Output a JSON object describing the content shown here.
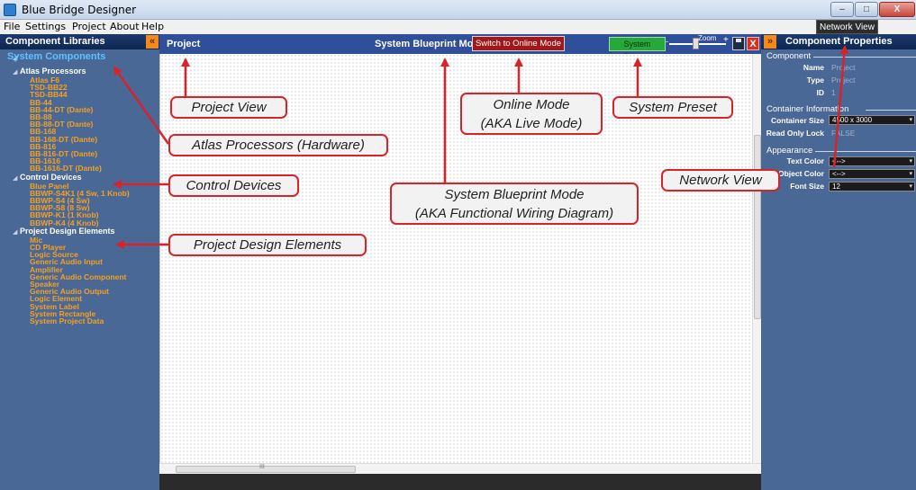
{
  "window": {
    "title": "Blue Bridge Designer",
    "controls": {
      "minimize": "–",
      "maximize": "□",
      "close": "X"
    }
  },
  "menu": {
    "file": "File",
    "settings": "Settings",
    "project": "Project",
    "about": "About",
    "help": "Help"
  },
  "tooltip": "Network View",
  "left_panel": {
    "title": "Component Libraries",
    "collapse_glyph": "«",
    "root": "System Components",
    "categories": [
      {
        "label": "Atlas Processors",
        "items": [
          "Atlas F6",
          "TSD-BB22",
          "TSD-BB44",
          "BB-44",
          "BB-44-DT (Dante)",
          "BB-88",
          "BB-88-DT (Dante)",
          "BB-168",
          "BB-168-DT (Dante)",
          "BB-816",
          "BB-816-DT (Dante)",
          "BB-1616",
          "BB-1616-DT (Dante)"
        ]
      },
      {
        "label": "Control Devices",
        "items": [
          "Blue Panel",
          "BBWP-S4K1 (4 Sw, 1 Knob)",
          "BBWP-S4 (4 Sw)",
          "BBWP-S8 (8 Sw)",
          "BBWP-K1 (1 Knob)",
          "BBWP-K4 (4 Knob)"
        ]
      },
      {
        "label": "Project Design Elements",
        "items": [
          "Mic",
          "CD Player",
          "Logic Source",
          "Generic Audio Input",
          "Amplifier",
          "Generic Audio Component",
          "Speaker",
          "Generic Audio Output",
          "Logic Element",
          "System Label",
          "System Rectangle",
          "System Project Data"
        ]
      }
    ]
  },
  "canvas_header": {
    "project": "Project",
    "mode": "System Blueprint Mode",
    "online_button": "Switch to Online Mode",
    "presets_button": "System Presets",
    "zoom_label": "Zoom",
    "zoom_minus": "-",
    "zoom_plus": "+",
    "close_glyph": "X"
  },
  "scroll_marker": "III",
  "right_panel": {
    "title": "Component Properties",
    "expand_glyph": "»",
    "component": {
      "title": "Component",
      "name_label": "Name",
      "name_value": "Project",
      "type_label": "Type",
      "type_value": "Project",
      "id_label": "ID",
      "id_value": "1"
    },
    "container": {
      "title": "Container Information",
      "size_label": "Container Size",
      "size_value": "4500 x 3000",
      "lock_label": "Read Only Lock",
      "lock_value": "FALSE"
    },
    "appearance": {
      "title": "Appearance",
      "text_color_label": "Text Color",
      "text_color_value": "<-->",
      "object_color_label": "Object Color",
      "object_color_value": "<-->",
      "font_size_label": "Font Size",
      "font_size_value": "12"
    }
  },
  "annotations": {
    "project_view": "Project View",
    "atlas": "Atlas Processors (Hardware)",
    "control": "Control Devices",
    "design": "Project Design Elements",
    "blueprint_1": "System Blueprint Mode",
    "blueprint_2": "(AKA Functional Wiring Diagram)",
    "online_1": "Online Mode",
    "online_2": "(AKA Live Mode)",
    "preset": "System Preset",
    "network": "Network View"
  },
  "colors": {
    "annotation_red": "#d6242a",
    "panel_blue": "#4a6896",
    "header_navy": "#0f2750",
    "leaf_orange": "#f5a020",
    "root_cyan": "#5ec1ff"
  }
}
